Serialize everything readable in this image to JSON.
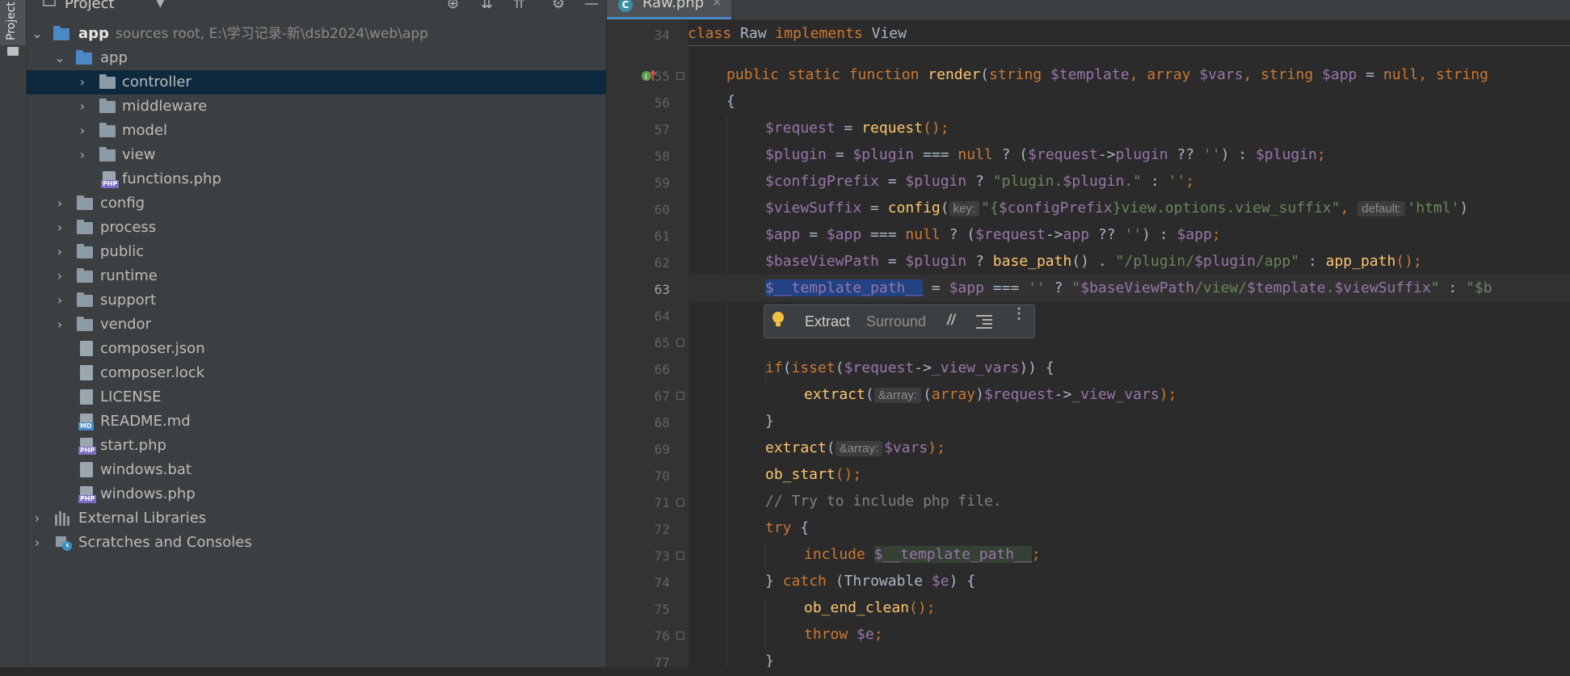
{
  "sidebar": {
    "vertical_tab": "Project"
  },
  "project_panel": {
    "title": "Project",
    "root": {
      "name": "app",
      "hint": "sources root,  E:\\学习记录-新\\dsb2024\\web\\app"
    },
    "tree": [
      {
        "label": "app",
        "type": "folder",
        "depth": 1,
        "expanded": true
      },
      {
        "label": "controller",
        "type": "folder",
        "depth": 2,
        "selected": true
      },
      {
        "label": "middleware",
        "type": "folder",
        "depth": 2
      },
      {
        "label": "model",
        "type": "folder",
        "depth": 2
      },
      {
        "label": "view",
        "type": "folder",
        "depth": 2
      },
      {
        "label": "functions.php",
        "type": "php",
        "depth": 2
      },
      {
        "label": "config",
        "type": "folder",
        "depth": 1
      },
      {
        "label": "process",
        "type": "folder",
        "depth": 1
      },
      {
        "label": "public",
        "type": "folder",
        "depth": 1
      },
      {
        "label": "runtime",
        "type": "folder",
        "depth": 1
      },
      {
        "label": "support",
        "type": "folder",
        "depth": 1
      },
      {
        "label": "vendor",
        "type": "folder",
        "depth": 1
      },
      {
        "label": "composer.json",
        "type": "file",
        "depth": 1
      },
      {
        "label": "composer.lock",
        "type": "file",
        "depth": 1
      },
      {
        "label": "LICENSE",
        "type": "file",
        "depth": 1
      },
      {
        "label": "README.md",
        "type": "md",
        "depth": 1
      },
      {
        "label": "start.php",
        "type": "php",
        "depth": 1
      },
      {
        "label": "windows.bat",
        "type": "file",
        "depth": 1
      },
      {
        "label": "windows.php",
        "type": "php",
        "depth": 1
      }
    ],
    "external_libraries": "External Libraries",
    "scratches": "Scratches and Consoles",
    "php_tag": "PHP",
    "md_tag": "MD"
  },
  "editor": {
    "tab": {
      "title": "Raw.php",
      "icon_letter": "C"
    },
    "line_numbers": [
      "34",
      "55",
      "56",
      "57",
      "58",
      "59",
      "60",
      "61",
      "62",
      "63",
      "64",
      "65",
      "66",
      "67",
      "68",
      "69",
      "70",
      "71",
      "72",
      "73",
      "74",
      "75",
      "76",
      "77"
    ],
    "current_line": "63",
    "code": {
      "l34": [
        "class",
        "Raw",
        "implements",
        "View"
      ],
      "l55": [
        "public static function",
        "render",
        "(",
        "string",
        "$template",
        ", ",
        "array",
        "$vars",
        ", ",
        "string",
        "$app",
        " = ",
        "null",
        ", ",
        "string"
      ],
      "l57": [
        "$request",
        " = ",
        "request",
        "();"
      ],
      "l58": [
        "$plugin",
        " = ",
        "$plugin",
        " === ",
        "null",
        " ? (",
        "$request",
        "->",
        "plugin",
        " ?? ",
        "''",
        ") : ",
        "$plugin",
        ";"
      ],
      "l59": [
        "$configPrefix",
        " = ",
        "$plugin",
        " ? ",
        "\"plugin.",
        "$plugin",
        ".\"",
        " : ",
        "''",
        ";"
      ],
      "l60": [
        "$viewSuffix",
        " = ",
        "config",
        "(",
        "key:",
        "\"{",
        "$configPrefix",
        "}",
        "view.options.view_suffix\"",
        ", ",
        "default:",
        "'html'",
        ")"
      ],
      "l61": [
        "$app",
        " = ",
        "$app",
        " === ",
        "null",
        " ? (",
        "$request",
        "->",
        "app",
        " ?? ",
        "''",
        ") : ",
        "$app",
        ";"
      ],
      "l62": [
        "$baseViewPath",
        " = ",
        "$plugin",
        " ? ",
        "base_path",
        "() . ",
        "\"/plugin/",
        "$plugin",
        "/app\"",
        " : ",
        "app_path",
        "();"
      ],
      "l63": [
        "$__template_path__",
        " = ",
        "$app",
        " === ",
        "''",
        " ? ",
        "\"",
        "$baseViewPath",
        "/view/",
        "$template",
        ".",
        "$viewSuffix",
        "\"",
        " : ",
        "\"$b"
      ],
      "l65": [
        "if",
        "(",
        "isset",
        "(",
        "$request",
        "->",
        "_view_vars",
        ")) {"
      ],
      "l66": [
        "extract",
        "(",
        "&array:",
        "(",
        "array",
        ")",
        "$request",
        "->",
        "_view_vars",
        ");"
      ],
      "l67": [
        "}"
      ],
      "l68": [
        "extract",
        "(",
        "&array:",
        "$vars",
        ");"
      ],
      "l69": [
        "ob_start",
        "();"
      ],
      "l70": [
        "// Try to include php file."
      ],
      "l71": [
        "try",
        " {"
      ],
      "l72": [
        "include",
        "$__template_path__",
        ";"
      ],
      "l73": [
        "} ",
        "catch",
        " (",
        "Throwable",
        " ",
        "$e",
        ") {"
      ],
      "l74": [
        "ob_end_clean",
        "();"
      ],
      "l75": [
        "throw",
        "$e",
        ";"
      ],
      "l76": [
        "}"
      ]
    },
    "popup": {
      "extract": "Extract",
      "surround": "Surround",
      "comment_glyph": "//",
      "more_glyph": "⋮"
    }
  },
  "colors": {
    "keyword": "#cc7832",
    "function": "#ffc66d",
    "variable": "#9876aa",
    "string": "#6a8759",
    "comment": "#808080",
    "selection": "#214283",
    "accent": "#4a88c7"
  }
}
